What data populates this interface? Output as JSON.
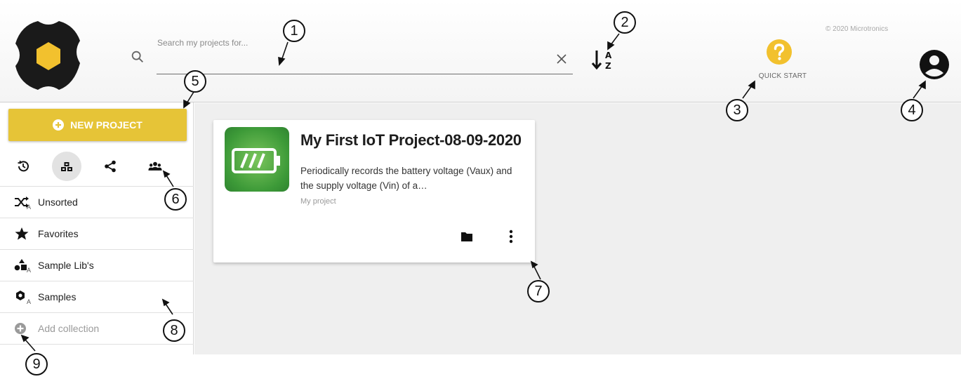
{
  "header": {
    "search_placeholder": "Search my projects for...",
    "copyright": "© 2020 Microtronics",
    "quickstart_label": "QUICK START"
  },
  "sidebar": {
    "new_project_label": "NEW PROJECT",
    "tabs": [
      "history-icon",
      "projects-icon",
      "share-icon",
      "group-icon"
    ],
    "collections": [
      {
        "label": "Unsorted",
        "icon": "shuffle-icon"
      },
      {
        "label": "Favorites",
        "icon": "star-icon"
      },
      {
        "label": "Sample Lib's",
        "icon": "shapes-icon"
      },
      {
        "label": "Samples",
        "icon": "cog-icon"
      },
      {
        "label": "Add collection",
        "icon": "add-circle-icon"
      }
    ],
    "subscript": "A"
  },
  "card": {
    "title": "My First IoT Project-08-09-2020",
    "description": "Periodically records the battery voltage (Vaux) and the supply voltage (Vin) of a…",
    "owner": "My project"
  },
  "callouts": [
    "1",
    "2",
    "3",
    "4",
    "5",
    "6",
    "7",
    "8",
    "9"
  ],
  "colors": {
    "accent": "#e6c437",
    "logo_yellow": "#f2c12e",
    "thumbnail_green": "#3d9a38"
  }
}
